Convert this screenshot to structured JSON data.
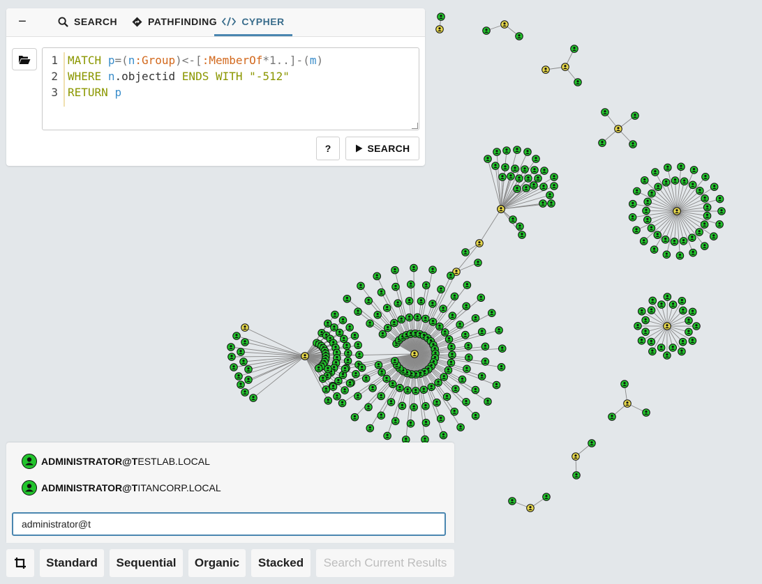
{
  "tabs": {
    "collapse": "−",
    "search": "SEARCH",
    "pathfinding": "PATHFINDING",
    "cypher": "CYPHER"
  },
  "editor": {
    "line_numbers": [
      "1",
      "2",
      "3"
    ],
    "line1": {
      "kw1": "MATCH",
      "p": "p",
      "eq": "=(",
      "n": "n",
      "label": ":Group",
      "mid": ")<-[",
      "rel": ":MemberOf",
      "star": "*1..",
      "close": "]-(",
      "m": "m",
      "end": ")"
    },
    "line2": {
      "kw1": "WHERE",
      "n": "n",
      "prop": ".objectid",
      "kw2": "ENDS WITH",
      "str": "\"-512\""
    },
    "line3": {
      "kw1": "RETURN",
      "p": "p"
    }
  },
  "buttons": {
    "help": "?",
    "search": "SEARCH"
  },
  "suggestions": [
    {
      "bold": "ADMINISTRATOR@T",
      "rest": "ESTLAB.LOCAL"
    },
    {
      "bold": "ADMINISTRATOR@T",
      "rest": "ITANCORP.LOCAL"
    }
  ],
  "search_input": {
    "value": "administrator@t"
  },
  "layout_buttons": {
    "standard": "Standard",
    "sequential": "Sequential",
    "organic": "Organic",
    "stacked": "Stacked",
    "search_current": "Search Current Results"
  },
  "colors": {
    "user_node": "#22c32c",
    "group_node": "#e6d84c",
    "edge": "#8a8a8a",
    "accent": "#4a86b0"
  }
}
